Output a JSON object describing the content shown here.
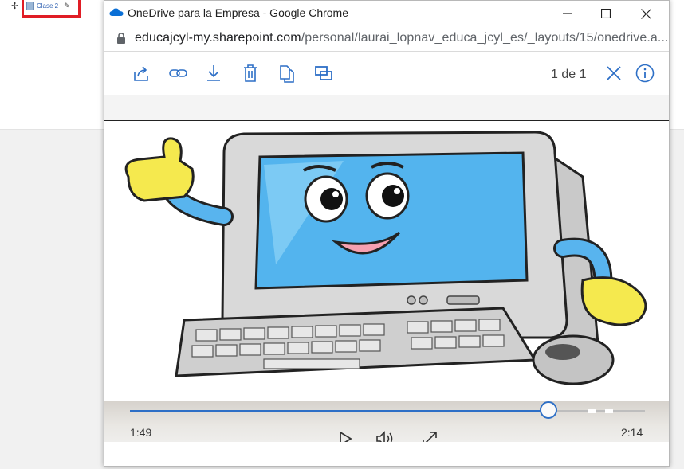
{
  "background": {
    "link_label": "Clase 2",
    "highlight_color": "#e01d25"
  },
  "window": {
    "title": "OneDrive para la Empresa - Google Chrome",
    "url_host": "educajcyl-my.sharepoint.com",
    "url_path": "/personal/laurai_lopnav_educa_jcyl_es/_layouts/15/onedrive.a..."
  },
  "toolbar": {
    "icons": [
      "share-icon",
      "link-icon",
      "download-icon",
      "delete-icon",
      "copy-icon",
      "move-icon"
    ],
    "page_count": "1 de 1",
    "accent": "#2d6fc6"
  },
  "player": {
    "current_time": "1:49",
    "total_time": "2:14",
    "progress_fraction": 0.813
  }
}
